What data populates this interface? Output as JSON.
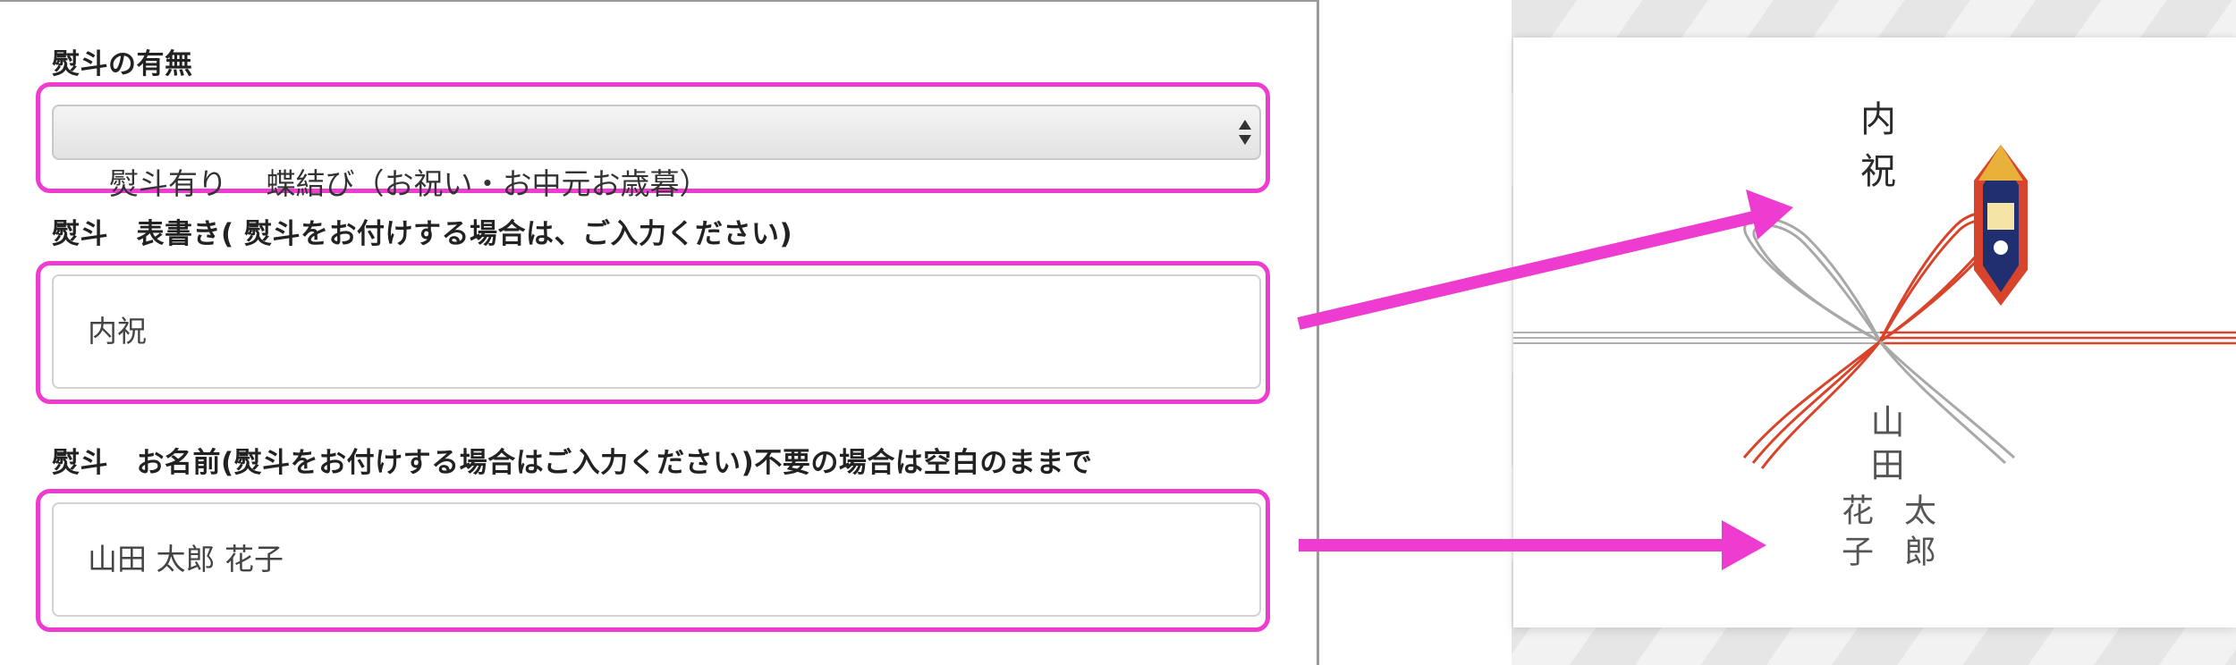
{
  "form": {
    "noshi_presence": {
      "label": "熨斗の有無",
      "selected": "熨斗有り　 蝶結び（お祝い・お中元お歳暮）"
    },
    "omotegaki": {
      "label": "熨斗　表書き( 熨斗をお付けする場合は、ご入力ください)",
      "value": "内祝"
    },
    "name": {
      "label": "熨斗　お名前(熨斗をお付けする場合はご入力ください)不要の場合は空白のままで",
      "value": "山田 太郎 花子"
    }
  },
  "noshi_preview": {
    "omotegaki": "内祝",
    "surname": "山田",
    "given_name_1": "太郎",
    "given_name_2": "花子"
  },
  "colors": {
    "highlight": "#ee3bd0",
    "arrow": "#ee3bd0",
    "mizuhiki_red": "#d8442b",
    "mizuhiki_silver": "#a8a8a8"
  },
  "icons": {
    "select": "updown-chevron-icon",
    "ornament": "noshi-ornament-icon"
  }
}
